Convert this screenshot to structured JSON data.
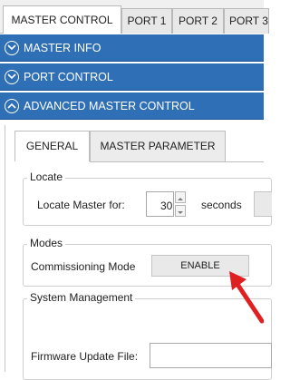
{
  "tabs": [
    "MASTER CONTROL",
    "PORT 1",
    "PORT 2",
    "PORT 3"
  ],
  "sections": [
    {
      "label": "MASTER INFO",
      "icon": "chevron-down-circle-icon"
    },
    {
      "label": "PORT CONTROL",
      "icon": "chevron-down-circle-icon"
    },
    {
      "label": "ADVANCED MASTER CONTROL",
      "icon": "chevron-up-circle-icon"
    }
  ],
  "subtabs": [
    "GENERAL",
    "MASTER PARAMETER"
  ],
  "locate": {
    "group_title": "Locate",
    "label": "Locate Master for:",
    "value": "30",
    "unit": "seconds"
  },
  "modes": {
    "group_title": "Modes",
    "label": "Commissioning Mode",
    "button": "ENABLE"
  },
  "system": {
    "group_title": "System Management",
    "firmware_label": "Firmware Update File:",
    "firmware_value": ""
  },
  "colors": {
    "accent": "#2f6fb6",
    "annotation_arrow": "#e02020"
  }
}
